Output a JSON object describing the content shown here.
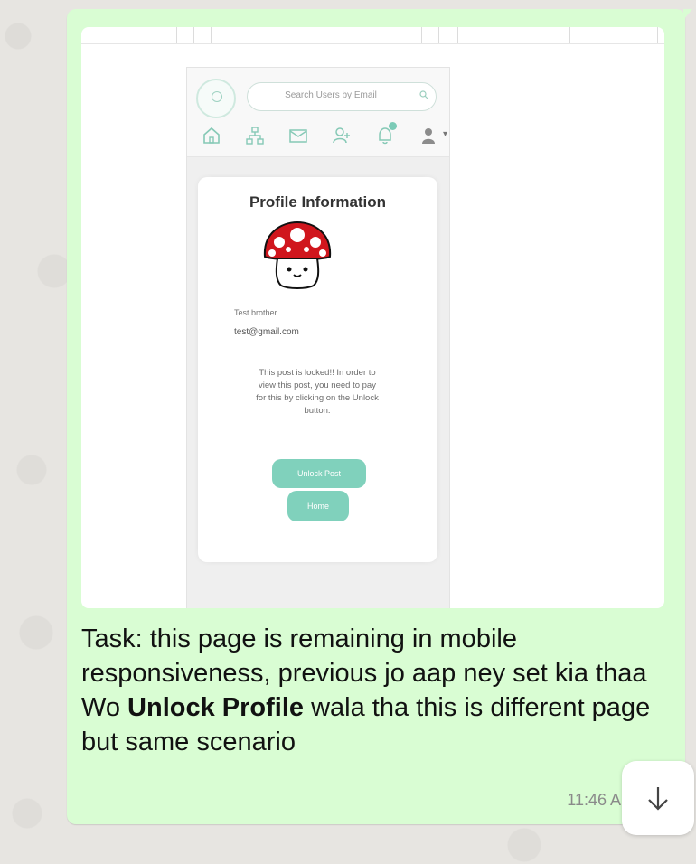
{
  "screenshot": {
    "search_placeholder": "Search Users by Email",
    "card_title": "Profile Information",
    "user_name": "Test brother",
    "user_email": "test@gmail.com",
    "locked_message": "This post is locked!! In order to view this post, you need to pay for this by clicking on the Unlock button.",
    "unlock_button": "Unlock Post",
    "home_button": "Home"
  },
  "message": {
    "text_part1": "Task: this page is remaining in mobile responsiveness, previous jo aap ney set kia thaa Wo ",
    "text_bold": "Unlock Profile",
    "text_part2": " wala tha this is different page but same scenario",
    "timestamp": "11:46 AM"
  },
  "icons": {
    "scroll_down": "chevron-down-icon",
    "nav": [
      "home-icon",
      "network-icon",
      "mail-icon",
      "add-user-icon",
      "bell-icon",
      "user-menu-icon"
    ]
  },
  "colors": {
    "bubble": "#d9fdd3",
    "accent": "#80d1bc",
    "mushroom_cap": "#d0161d"
  }
}
